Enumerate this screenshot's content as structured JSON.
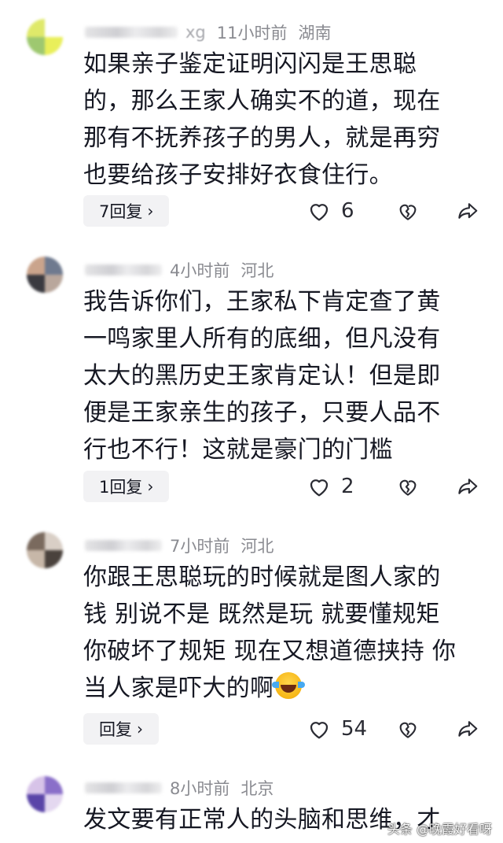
{
  "comments": [
    {
      "time": "11小时前",
      "location": "湖南",
      "name_fragment": "xg",
      "text": "如果亲子鉴定证明闪闪是王思聪\n的，那么王家人确实不的道，现在\n那有不抚养孩子的男人，就是再穷\n也要给孩子安排好衣食住行。",
      "reply_label": "7回复",
      "likes": "6",
      "avatar_colors": [
        "#dfe96a",
        "#9ec870",
        "#e9ef5a",
        "#ffffff",
        "#d8e65c",
        "#b3d27c"
      ]
    },
    {
      "time": "4小时前",
      "location": "河北",
      "text": "我告诉你们，王家私下肯定查了黄\n一鸣家里人所有的底细，但凡没有\n太大的黑历史王家肯定认！但是即\n便是王家亲生的孩子，只要人品不\n行也不行！这就是豪门的门槛",
      "reply_label": "1回复",
      "likes": "2",
      "avatar_colors": [
        "#8f7667",
        "#6f7a8f",
        "#caa48c",
        "#3a3a40",
        "#b9a79c",
        "#4d4f5a"
      ]
    },
    {
      "time": "7小时前",
      "location": "河北",
      "text": "你跟王思聪玩的时候就是图人家的\n钱 别说不是 既然是玩 就要懂规矩\n你破坏了规矩 现在又想道德挟持 你\n当人家是吓大的啊",
      "reply_label": "回复",
      "likes": "54",
      "avatar_colors": [
        "#7a6a5e",
        "#c7b7a8",
        "#4a423d",
        "#d9cfc6",
        "#9c8a7c",
        "#b6a597"
      ]
    },
    {
      "time": "8小时前",
      "location": "北京",
      "text": "发文要有正常人的头脑和思维，才",
      "avatar_colors": [
        "#d7c3e8",
        "#8a6fc9",
        "#5a45a8",
        "#c8b2e0",
        "#6a52b8",
        "#e4d8f0"
      ]
    }
  ],
  "watermark": "头条 @晚霞好看呀"
}
